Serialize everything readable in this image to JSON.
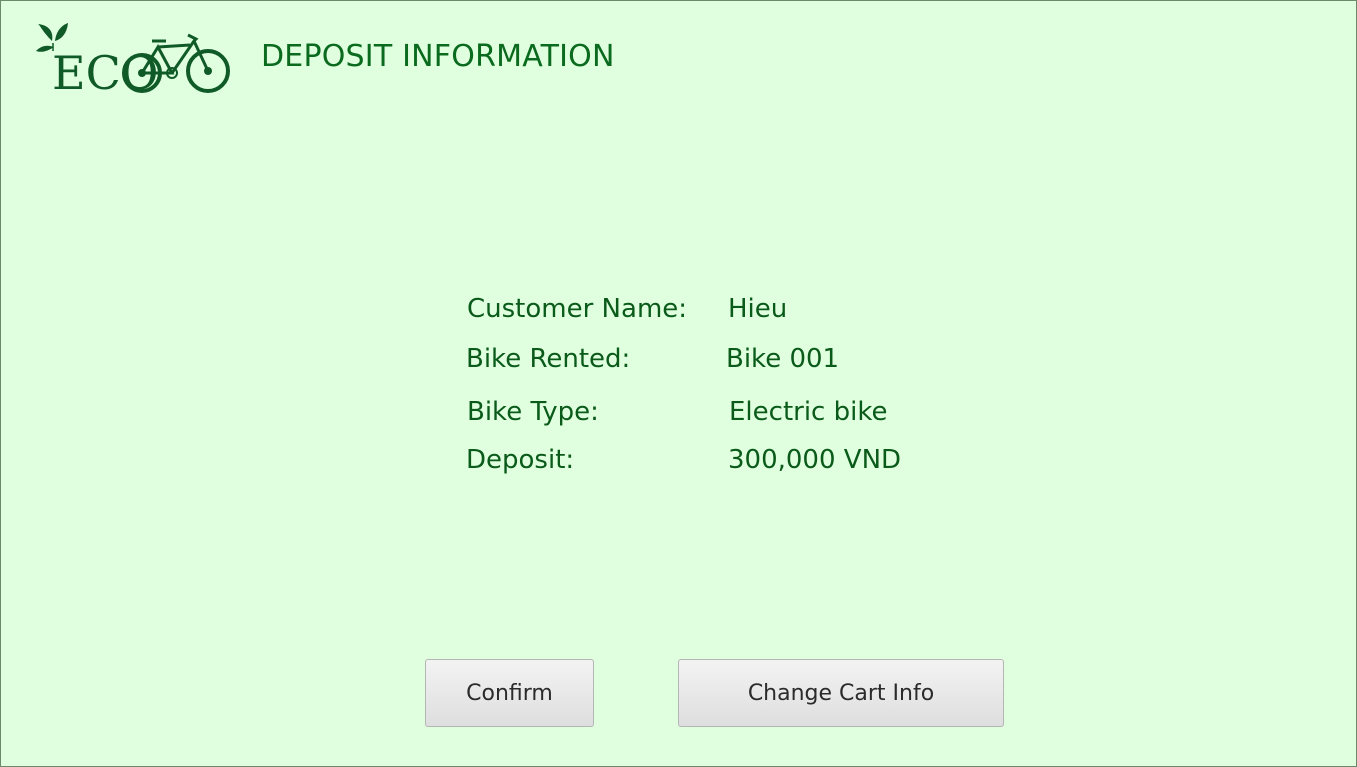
{
  "header": {
    "logo_text": "ECO",
    "title": "DEPOSIT INFORMATION"
  },
  "info": {
    "customer_name_label": "Customer Name:",
    "customer_name_value": "Hieu",
    "bike_rented_label": "Bike Rented:",
    "bike_rented_value": "Bike 001",
    "bike_type_label": "Bike Type:",
    "bike_type_value": "Electric bike",
    "deposit_label": "Deposit:",
    "deposit_value": "300,000 VND"
  },
  "actions": {
    "confirm_label": "Confirm",
    "change_cart_label": "Change Cart Info"
  },
  "colors": {
    "background": "#e0ffdf",
    "accent_green": "#0a6a1e",
    "logo_green": "#0f5a26"
  }
}
